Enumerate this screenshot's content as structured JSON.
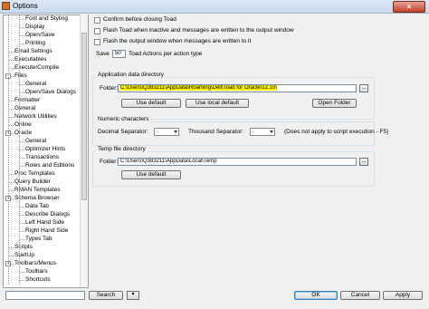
{
  "window": {
    "title": "Options",
    "close_glyph": "×"
  },
  "tree": {
    "items": [
      {
        "label": "Font and Styling",
        "level": 1
      },
      {
        "label": "Display",
        "level": 1
      },
      {
        "label": "Open/Save",
        "level": 1
      },
      {
        "label": "Printing",
        "level": 1
      },
      {
        "label": "Email Settings",
        "level": 0
      },
      {
        "label": "Executables",
        "level": 0
      },
      {
        "label": "Execute/Compile",
        "level": 0
      },
      {
        "label": "Files",
        "level": 0,
        "expander": "-"
      },
      {
        "label": "General",
        "level": 1
      },
      {
        "label": "Open/Save Dialogs",
        "level": 1
      },
      {
        "label": "Formatter",
        "level": 0
      },
      {
        "label": "General",
        "level": 0
      },
      {
        "label": "Network Utilities",
        "level": 0
      },
      {
        "label": "Online",
        "level": 0
      },
      {
        "label": "Oracle",
        "level": 0,
        "expander": "-"
      },
      {
        "label": "General",
        "level": 1
      },
      {
        "label": "Optimizer Hints",
        "level": 1
      },
      {
        "label": "Transactions",
        "level": 1
      },
      {
        "label": "Roles and Editions",
        "level": 1
      },
      {
        "label": "Proc Templates",
        "level": 0
      },
      {
        "label": "Query Builder",
        "level": 0
      },
      {
        "label": "RMAN Templates",
        "level": 0
      },
      {
        "label": "Schema Browser",
        "level": 0,
        "expander": "-"
      },
      {
        "label": "Data Tab",
        "level": 1
      },
      {
        "label": "Describe Dialogs",
        "level": 1
      },
      {
        "label": "Left Hand Side",
        "level": 1
      },
      {
        "label": "Right Hand Side",
        "level": 1
      },
      {
        "label": "Types Tab",
        "level": 1
      },
      {
        "label": "Scripts",
        "level": 0
      },
      {
        "label": "StartUp",
        "level": 0
      },
      {
        "label": "Toolbars/Menus",
        "level": 0,
        "expander": "-"
      },
      {
        "label": "Toolbars",
        "level": 1
      },
      {
        "label": "Shortcuts",
        "level": 1
      }
    ]
  },
  "options": {
    "confirm_close": "Confirm before closing Toad",
    "flash_inactive": "Flash Toad when inactive and messages are written to the output window",
    "flash_output": "Flash the output window when messages are written to it",
    "save_label": "Save",
    "save_value": "50",
    "save_suffix": "Toad Actions per action type"
  },
  "app_data": {
    "group_label": "Application data directory",
    "folder_label": "Folder:",
    "folder_value": "C:\\Users\\Q383211\\AppData\\Roaming\\Dell\\Toad for Oracle\\12.10\\",
    "browse_label": "...",
    "use_default": "Use default",
    "use_local_default": "Use local default",
    "open_folder": "Open Folder"
  },
  "numeric": {
    "group_label": "Numeric characters",
    "decimal_label": "Decimal Separator:",
    "decimal_value": ".",
    "thousand_label": "Thousand Separator:",
    "thousand_value": ",",
    "note": "(Does not apply to script execution - F5)"
  },
  "temp": {
    "group_label": "Temp file directory",
    "folder_label": "Folder:",
    "folder_value": "C:\\Users\\Q383211\\AppData\\Local\\Temp",
    "browse_label": "...",
    "use_default": "Use default"
  },
  "footer": {
    "search_placeholder": "",
    "search_button": "Search",
    "ok": "OK",
    "cancel": "Cancel",
    "apply": "Apply"
  }
}
